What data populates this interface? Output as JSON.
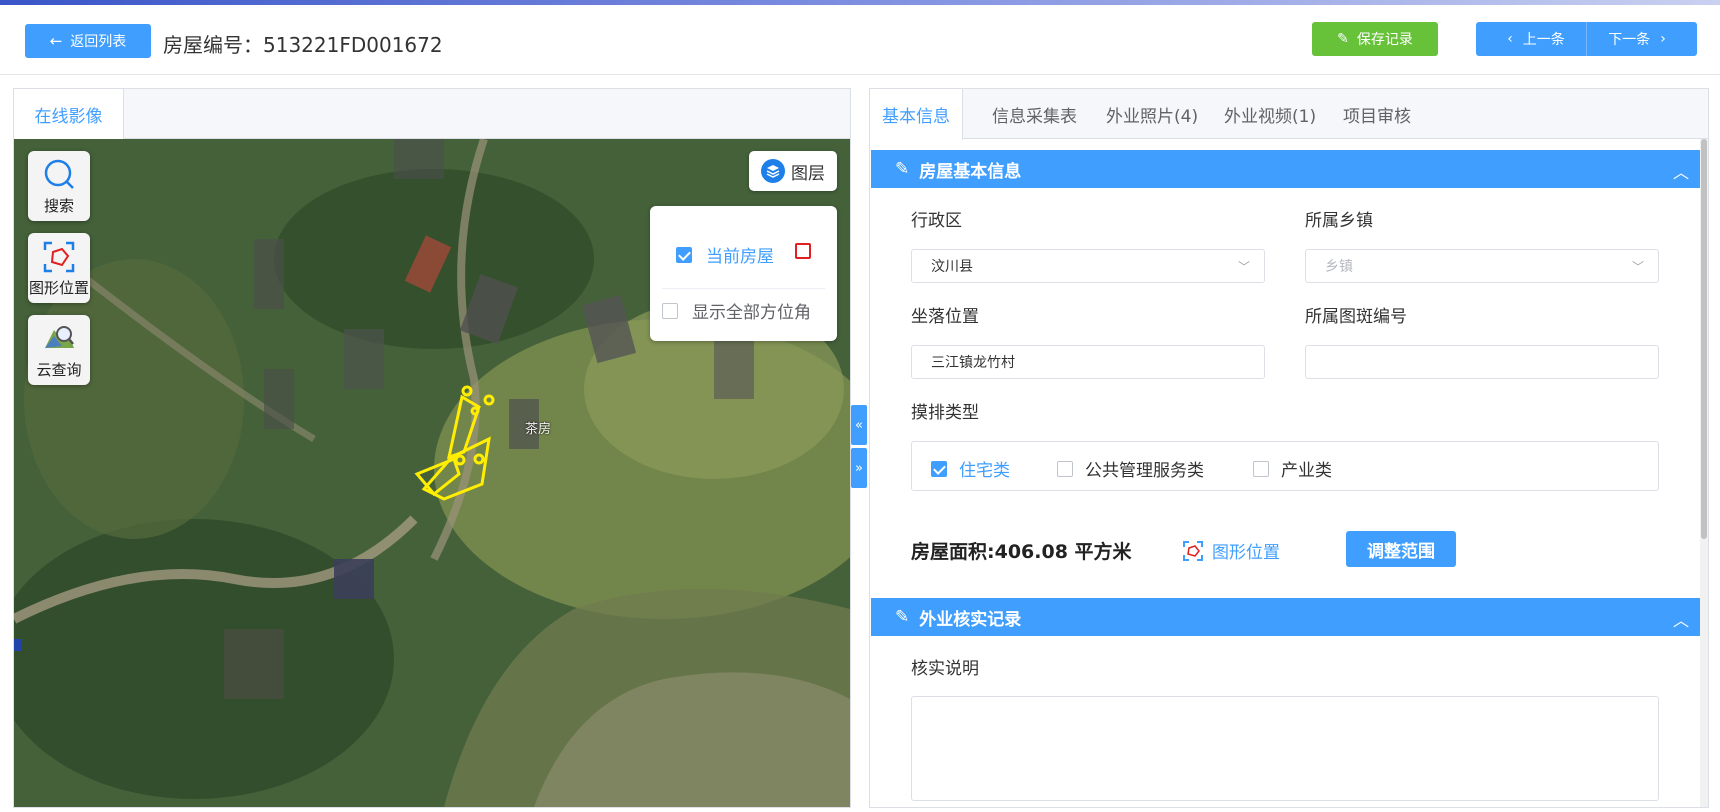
{
  "header": {
    "back_label": "返回列表",
    "house_title": "房屋编号：513221FD001672",
    "save_label": "保存记录",
    "prev_label": "上一条",
    "next_label": "下一条"
  },
  "left": {
    "tab": "在线影像",
    "tools": {
      "search": "搜索",
      "shape": "图形位置",
      "cloud": "云查询"
    },
    "layer_button": "图层",
    "layer_popup": {
      "current_house": "当前房屋",
      "show_all": "显示全部方位角"
    },
    "map_label": "茶房"
  },
  "right": {
    "tabs": [
      "基本信息",
      "信息采集表",
      "外业照片(4)",
      "外业视频(1)",
      "项目审核"
    ],
    "section1": {
      "title": "房屋基本信息",
      "district_label": "行政区",
      "district_value": "汶川县",
      "town_label": "所属乡镇",
      "town_placeholder": "乡镇",
      "location_label": "坐落位置",
      "location_value": "三江镇龙竹村",
      "patch_label": "所属图斑编号",
      "patch_value": "",
      "type_label": "摸排类型",
      "types": [
        {
          "label": "住宅类",
          "checked": true
        },
        {
          "label": "公共管理服务类",
          "checked": false
        },
        {
          "label": "产业类",
          "checked": false
        }
      ],
      "area_text": "房屋面积:406.08 平方米",
      "shape_link": "图形位置",
      "adjust_button": "调整范围"
    },
    "section2": {
      "title": "外业核实记录",
      "note_label": "核实说明"
    }
  },
  "colors": {
    "primary": "#409eff",
    "success": "#67c23a",
    "highlight": "#ffee00",
    "danger": "#e02020"
  }
}
